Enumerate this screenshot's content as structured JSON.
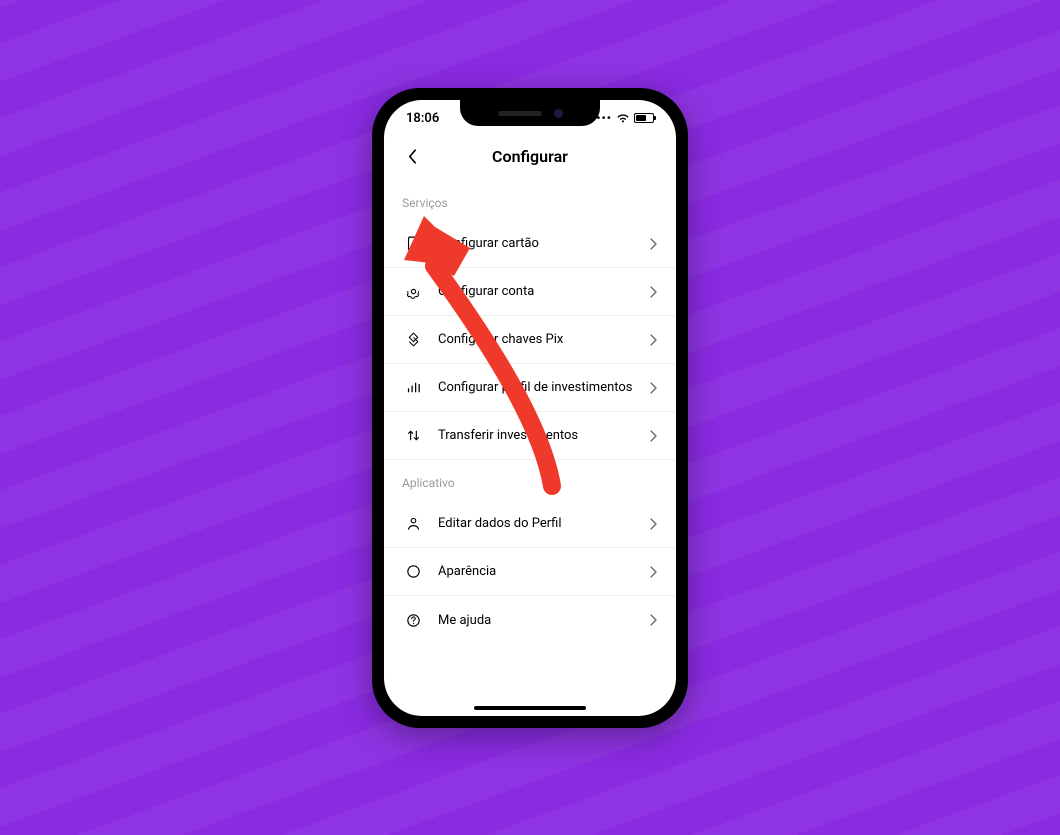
{
  "status_bar": {
    "time": "18:06"
  },
  "header": {
    "title": "Configurar"
  },
  "sections": {
    "services": {
      "title": "Serviços",
      "items": [
        {
          "label": "Configurar cartão",
          "icon": "card-icon"
        },
        {
          "label": "Configurar conta",
          "icon": "account-icon"
        },
        {
          "label": "Configurar chaves Pix",
          "icon": "pix-icon"
        },
        {
          "label": "Configurar perfil de investimentos",
          "icon": "investments-icon"
        },
        {
          "label": "Transferir investimentos",
          "icon": "transfer-icon"
        }
      ]
    },
    "app": {
      "title": "Aplicativo",
      "items": [
        {
          "label": "Editar dados do Perfil",
          "icon": "profile-icon"
        },
        {
          "label": "Aparência",
          "icon": "appearance-icon"
        },
        {
          "label": "Me ajuda",
          "icon": "help-icon"
        }
      ]
    }
  },
  "annotation": {
    "arrow_color": "#ef3a2b"
  },
  "colors": {
    "background": "#8a2be2"
  }
}
